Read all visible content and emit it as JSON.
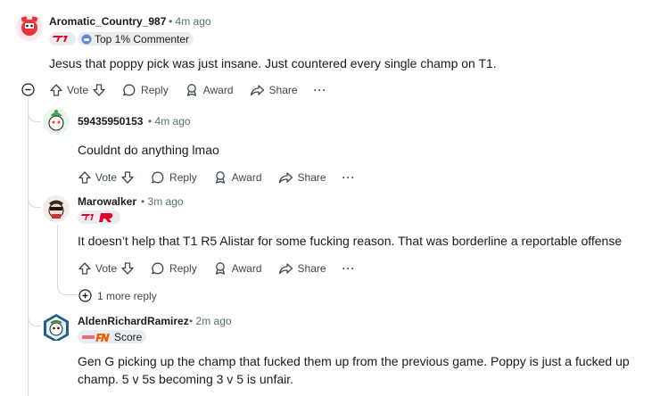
{
  "comments": [
    {
      "author": "Aromatic_Country_987",
      "separator": "•",
      "time": "4m ago",
      "flair": "Top 1% Commenter",
      "body": "Jesus that poppy pick was just insane. Just countered every single champ on T1."
    },
    {
      "author": "59435950153",
      "separator": "•",
      "time": "4m ago",
      "body": "Couldnt do anything lmao"
    },
    {
      "author": "Marowalker",
      "separator": "•",
      "time": "3m ago",
      "body": "It doesn’t help that T1 R5 Alistar for some fucking reason. That was borderline a reportable offense"
    },
    {
      "author": "AldenRichardRamirez",
      "separator": "•",
      "time": "2m ago",
      "flair": "Score",
      "body_line1": "Gen G picking up the champ that fucked them up from the previous game. Poppy is just a fucked up",
      "body_line2": "champ. 5 v 5s becoming 3 v 5 is unfair."
    }
  ],
  "actions": {
    "vote": "Vote",
    "reply": "Reply",
    "award": "Award",
    "share": "Share",
    "more": "···"
  },
  "more_replies": "1 more reply",
  "colors": {
    "text": "#1a1a1b",
    "meta": "#576f76",
    "thread_line": "#d7dadc",
    "flair_bg": "#eaedef",
    "t1_red": "#e2012d"
  },
  "icons": [
    "upvote-icon",
    "downvote-icon",
    "reply-bubble-icon",
    "award-icon",
    "share-arrow-icon",
    "collapse-minus-icon",
    "expand-plus-icon"
  ]
}
